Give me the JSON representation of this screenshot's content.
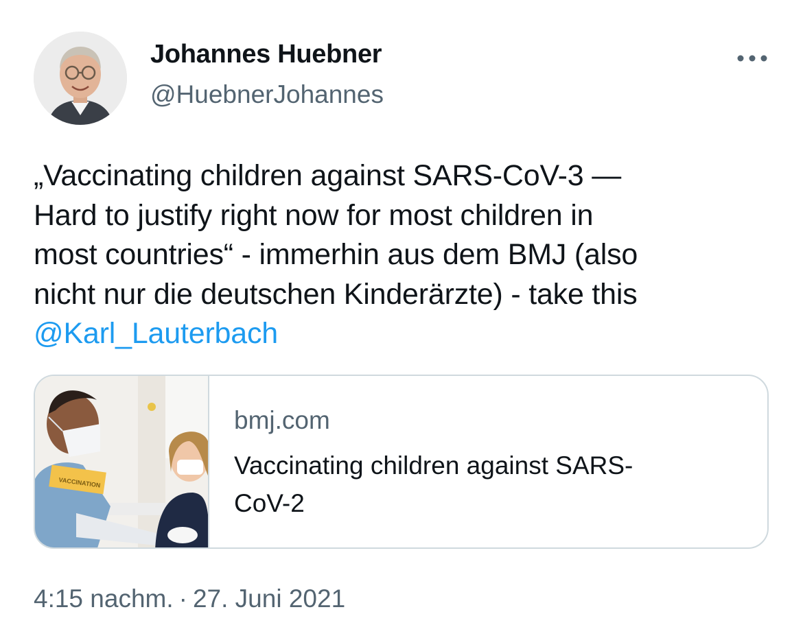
{
  "author": {
    "display_name": "Johannes Huebner",
    "handle": "@HuebnerJohannes",
    "avatar_icon": "user-avatar"
  },
  "more_icon": "more-horizontal-icon",
  "tweet": {
    "lines": [
      "„Vaccinating children against SARS-CoV-3 —",
      "Hard to justify right now for most children in",
      "most countries“ - immerhin aus dem BMJ (also",
      "nicht nur die deutschen Kinderärzte) - take this"
    ],
    "mention": "@Karl_Lauterbach"
  },
  "card": {
    "domain": "bmj.com",
    "title_lines": [
      "Vaccinating children against SARS-",
      "CoV-2"
    ],
    "image_icon": "vaccination-photo",
    "sign_text": "VACCINATION"
  },
  "timestamp": {
    "time": "4:15 nachm.",
    "separator": "·",
    "date": "27. Juni 2021"
  },
  "colors": {
    "text": "#0f1419",
    "secondary": "#536471",
    "link": "#1d9bf0",
    "border": "#cfd9de"
  }
}
